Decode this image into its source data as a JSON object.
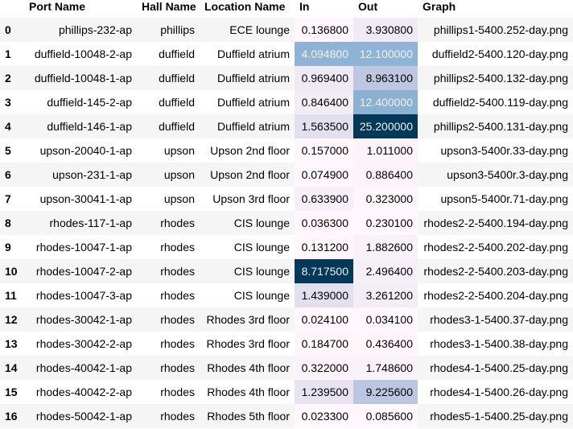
{
  "table": {
    "columns": [
      "",
      "Port Name",
      "Hall Name",
      "Location Name",
      "In",
      "Out",
      "Graph"
    ],
    "rows": [
      {
        "index": "0",
        "port": "phillips-232-ap",
        "hall": "phillips",
        "location": "ECE lounge",
        "in": "0.136800",
        "out": "3.930800",
        "graph": "phillips1-5400.252-day.png",
        "in_bg": "#fff7fb",
        "in_fg": "#000000",
        "out_bg": "#f0eaf4",
        "out_fg": "#000000"
      },
      {
        "index": "1",
        "port": "duffield-10048-2-ap",
        "hall": "duffield",
        "location": "Duffield atrium",
        "in": "4.094800",
        "out": "12.100000",
        "graph": "duffield2-5400.120-day.png",
        "in_bg": "#8fb3d4",
        "in_fg": "#f1f1f1",
        "out_bg": "#8fb3d4",
        "out_fg": "#f1f1f1"
      },
      {
        "index": "2",
        "port": "duffield-10048-1-ap",
        "hall": "duffield",
        "location": "Duffield atrium",
        "in": "0.969400",
        "out": "8.963100",
        "graph": "phillips2-5400.132-day.png",
        "in_bg": "#efe9f3",
        "in_fg": "#000000",
        "out_bg": "#bdc8e0",
        "out_fg": "#000000"
      },
      {
        "index": "3",
        "port": "duffield-145-2-ap",
        "hall": "duffield",
        "location": "Duffield atrium",
        "in": "0.846400",
        "out": "12.400000",
        "graph": "duffield2-5400.119-day.png",
        "in_bg": "#f2ecf5",
        "in_fg": "#000000",
        "out_bg": "#8ab0d2",
        "out_fg": "#f1f1f1"
      },
      {
        "index": "4",
        "port": "duffield-146-1-ap",
        "hall": "duffield",
        "location": "Duffield atrium",
        "in": "1.563500",
        "out": "25.200000",
        "graph": "phillips2-5400.131-day.png",
        "in_bg": "#e2e0ee",
        "in_fg": "#000000",
        "out_bg": "#023858",
        "out_fg": "#f1f1f1"
      },
      {
        "index": "5",
        "port": "upson-20040-1-ap",
        "hall": "upson",
        "location": "Upson 2nd floor",
        "in": "0.157000",
        "out": "1.011000",
        "graph": "upson3-5400r.33-day.png",
        "in_bg": "#fff7fb",
        "in_fg": "#000000",
        "out_bg": "#fcf4fa",
        "out_fg": "#000000"
      },
      {
        "index": "6",
        "port": "upson-231-1-ap",
        "hall": "upson",
        "location": "Upson 2nd floor",
        "in": "0.074900",
        "out": "0.886400",
        "graph": "upson3-5400r.3-day.png",
        "in_bg": "#fff7fb",
        "in_fg": "#000000",
        "out_bg": "#fcf4fa",
        "out_fg": "#000000"
      },
      {
        "index": "7",
        "port": "upson-30041-1-ap",
        "hall": "upson",
        "location": "Upson 3rd floor",
        "in": "0.633900",
        "out": "0.323000",
        "graph": "upson5-5400r.71-day.png",
        "in_bg": "#f6eff7",
        "in_fg": "#000000",
        "out_bg": "#fef6fb",
        "out_fg": "#000000"
      },
      {
        "index": "8",
        "port": "rhodes-117-1-ap",
        "hall": "rhodes",
        "location": "CIS lounge",
        "in": "0.036300",
        "out": "0.230100",
        "graph": "rhodes2-2-5400.194-day.png",
        "in_bg": "#fff7fb",
        "in_fg": "#000000",
        "out_bg": "#fff7fb",
        "out_fg": "#000000"
      },
      {
        "index": "9",
        "port": "rhodes-10047-1-ap",
        "hall": "rhodes",
        "location": "CIS lounge",
        "in": "0.131200",
        "out": "1.882600",
        "graph": "rhodes2-2-5400.202-day.png",
        "in_bg": "#fff7fb",
        "in_fg": "#000000",
        "out_bg": "#f8f1f8",
        "out_fg": "#000000"
      },
      {
        "index": "10",
        "port": "rhodes-10047-2-ap",
        "hall": "rhodes",
        "location": "CIS lounge",
        "in": "8.717500",
        "out": "2.496400",
        "graph": "rhodes2-2-5400.203-day.png",
        "in_bg": "#023858",
        "in_fg": "#f1f1f1",
        "out_bg": "#f6eff7",
        "out_fg": "#000000"
      },
      {
        "index": "11",
        "port": "rhodes-10047-3-ap",
        "hall": "rhodes",
        "location": "CIS lounge",
        "in": "1.439000",
        "out": "3.261200",
        "graph": "rhodes2-2-5400.204-day.png",
        "in_bg": "#e3e0ee",
        "in_fg": "#000000",
        "out_bg": "#f3edf5",
        "out_fg": "#000000"
      },
      {
        "index": "12",
        "port": "rhodes-30042-1-ap",
        "hall": "rhodes",
        "location": "Rhodes 3rd floor",
        "in": "0.024100",
        "out": "0.034100",
        "graph": "rhodes3-1-5400.37-day.png",
        "in_bg": "#fff7fb",
        "in_fg": "#000000",
        "out_bg": "#fff7fb",
        "out_fg": "#000000"
      },
      {
        "index": "13",
        "port": "rhodes-30042-2-ap",
        "hall": "rhodes",
        "location": "Rhodes 3rd floor",
        "in": "0.184700",
        "out": "0.436400",
        "graph": "rhodes3-1-5400.38-day.png",
        "in_bg": "#fdf5fa",
        "in_fg": "#000000",
        "out_bg": "#fef6fb",
        "out_fg": "#000000"
      },
      {
        "index": "14",
        "port": "rhodes-40042-1-ap",
        "hall": "rhodes",
        "location": "Rhodes 4th floor",
        "in": "0.322000",
        "out": "1.748600",
        "graph": "rhodes4-1-5400.25-day.png",
        "in_bg": "#fbf3f9",
        "in_fg": "#000000",
        "out_bg": "#f9f2f8",
        "out_fg": "#000000"
      },
      {
        "index": "15",
        "port": "rhodes-40042-2-ap",
        "hall": "rhodes",
        "location": "Rhodes 4th floor",
        "in": "1.239500",
        "out": "9.225600",
        "graph": "rhodes4-1-5400.26-day.png",
        "in_bg": "#e7e3f0",
        "in_fg": "#000000",
        "out_bg": "#bbc7e0",
        "out_fg": "#000000"
      },
      {
        "index": "16",
        "port": "rhodes-50042-1-ap",
        "hall": "rhodes",
        "location": "Rhodes 5th floor",
        "in": "0.023300",
        "out": "0.085600",
        "graph": "rhodes5-1-5400.25-day.png",
        "in_bg": "#fff7fb",
        "in_fg": "#000000",
        "out_bg": "#fff7fb",
        "out_fg": "#000000"
      }
    ]
  }
}
